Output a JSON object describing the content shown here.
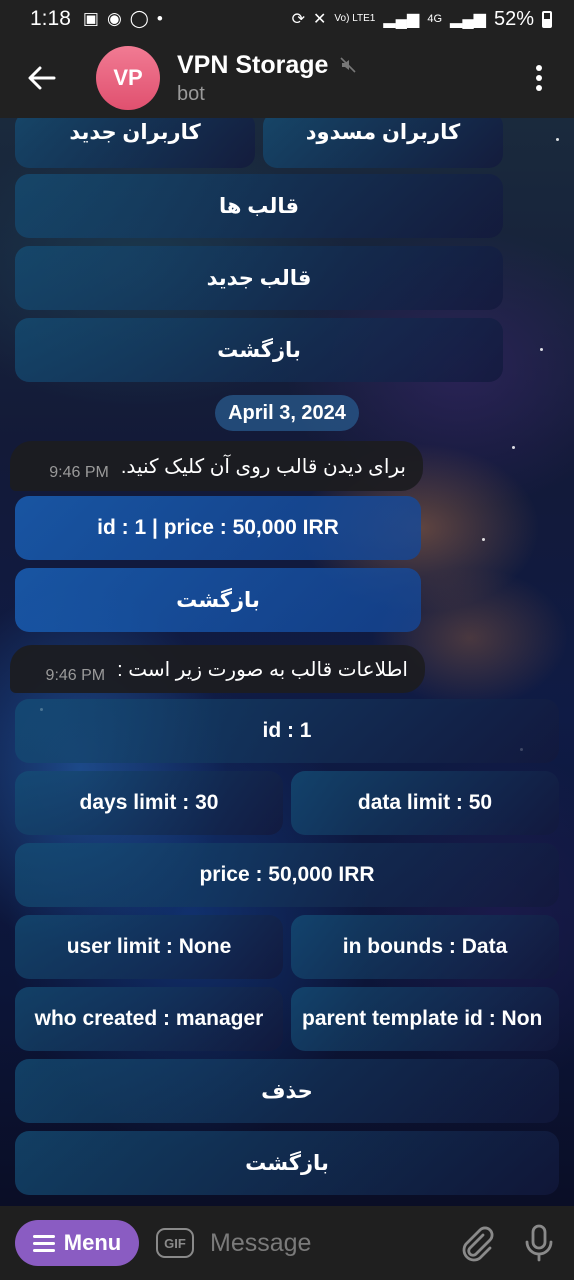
{
  "status_bar": {
    "time": "1:18",
    "battery": "52%",
    "network": "4G",
    "volte": "Vo) LTE1"
  },
  "header": {
    "avatar_initials": "VP",
    "title": "VPN Storage",
    "subtitle": "bot"
  },
  "keyboard_top": {
    "row1": [
      "کاربران مسدود",
      "کاربران جدید"
    ],
    "templates": "قالب ها",
    "new_template": "قالب جدید",
    "back": "بازگشت"
  },
  "date_separator": "April 3, 2024",
  "message1": {
    "text": "برای دیدن قالب روی آن کلیک کنید.",
    "time": "9:46 PM"
  },
  "keyboard1": {
    "template_item": "id : 1 | price : 50,000 IRR",
    "back": "بازگشت"
  },
  "message2": {
    "text": "اطلاعات قالب به صورت زیر است :",
    "time": "9:46 PM"
  },
  "keyboard2": {
    "id": "id : 1",
    "data_limit": "data limit : 50",
    "days_limit": "days limit : 30",
    "price": "price : 50,000 IRR",
    "in_bounds": "in bounds : Data",
    "user_limit": "user limit : None",
    "parent_template": "parent template id : Non",
    "who_created": "who created : manager",
    "delete": "حذف",
    "back": "بازگشت"
  },
  "bottom_bar": {
    "menu_label": "Menu",
    "gif_label": "GIF",
    "message_placeholder": "Message"
  },
  "colors": {
    "header_bg": "#212121",
    "avatar": "#e8607f",
    "menu_button": "#8a5cc2",
    "date_pill": "#285a8c"
  }
}
